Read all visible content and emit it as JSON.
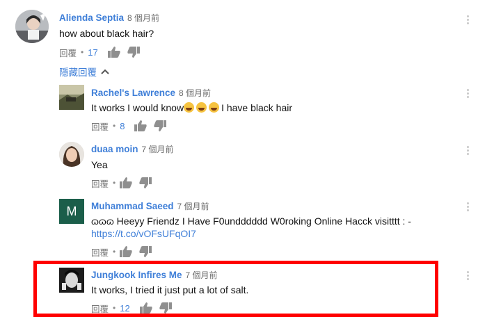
{
  "top_comment": {
    "author": "Alienda Septia",
    "time": "8 個月前",
    "text": "how about black hair?",
    "reply_label": "回覆",
    "like_count": "17"
  },
  "hide_replies_label": "隱藏回覆",
  "replies": [
    {
      "author": "Rachel's Lawrence",
      "time": "8 個月前",
      "text_before": "It works I would know",
      "emoji": "face-with-tears-of-joy",
      "text_after": "I have black hair",
      "reply_label": "回覆",
      "like_count": "8"
    },
    {
      "author": "duaa moin",
      "time": "7 個月前",
      "text": "Yea",
      "reply_label": "回覆"
    },
    {
      "author": "Muhammad Saeed",
      "avatar_letter": "M",
      "time": "7 個月前",
      "text": "ɷɷɷ Heeyy Friendz I Have F0undddddd W0roking Online Hacck visitttt  : -",
      "link": "https://t.co/vOFsUFqOI7",
      "reply_label": "回覆"
    },
    {
      "author": "Jungkook Infires Me",
      "time": "7 個月前",
      "text": "It works, I tried it just put a lot of salt.",
      "reply_label": "回覆",
      "like_count": "12"
    }
  ],
  "colors": {
    "author": "#3f7fd8",
    "highlight": "#ff0000",
    "avatar_letter_bg": "#1b5e4a"
  }
}
